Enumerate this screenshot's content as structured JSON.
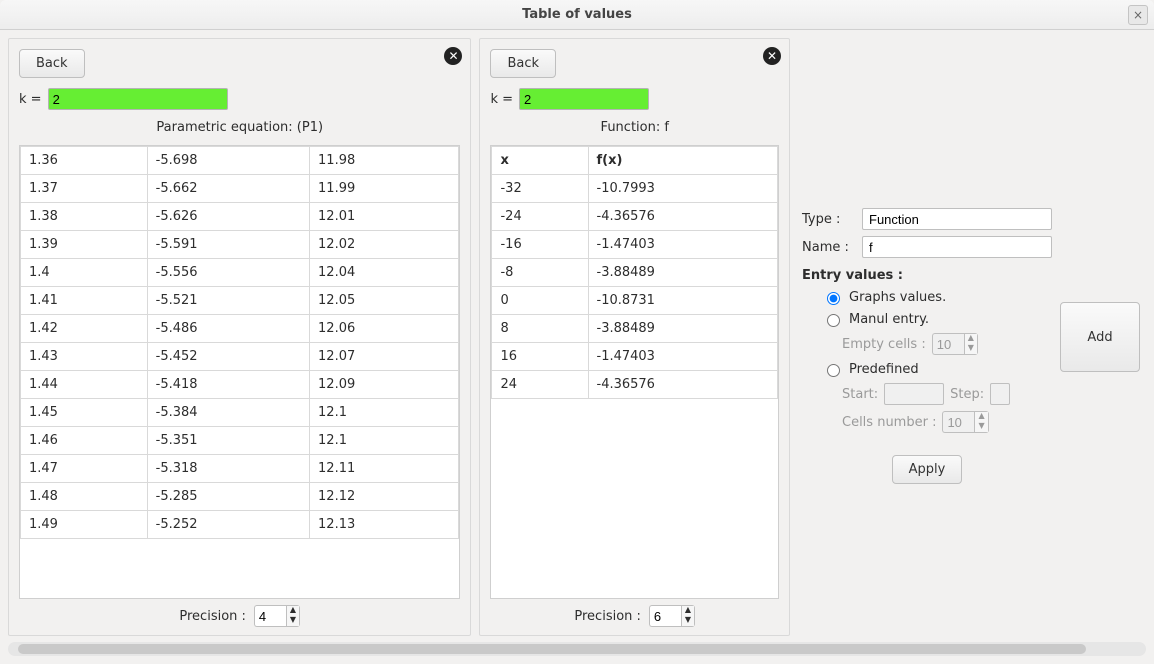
{
  "window": {
    "title": "Table of values",
    "close_glyph": "×"
  },
  "panel_left": {
    "close_glyph": "✕",
    "back_label": "Back",
    "k_label": "k = ",
    "k_value": "2",
    "title": "Parametric equation: (P1)",
    "precision_label": "Precision :",
    "precision_value": "4",
    "rows": [
      [
        "1.36",
        "-5.698",
        "11.98"
      ],
      [
        "1.37",
        "-5.662",
        "11.99"
      ],
      [
        "1.38",
        "-5.626",
        "12.01"
      ],
      [
        "1.39",
        "-5.591",
        "12.02"
      ],
      [
        "1.4",
        "-5.556",
        "12.04"
      ],
      [
        "1.41",
        "-5.521",
        "12.05"
      ],
      [
        "1.42",
        "-5.486",
        "12.06"
      ],
      [
        "1.43",
        "-5.452",
        "12.07"
      ],
      [
        "1.44",
        "-5.418",
        "12.09"
      ],
      [
        "1.45",
        "-5.384",
        "12.1"
      ],
      [
        "1.46",
        "-5.351",
        "12.1"
      ],
      [
        "1.47",
        "-5.318",
        "12.11"
      ],
      [
        "1.48",
        "-5.285",
        "12.12"
      ],
      [
        "1.49",
        "-5.252",
        "12.13"
      ]
    ]
  },
  "panel_middle": {
    "close_glyph": "✕",
    "back_label": "Back",
    "k_label": "k = ",
    "k_value": "2",
    "title": "Function: f",
    "precision_label": "Precision :",
    "precision_value": "6",
    "headers": [
      "x",
      "f(x)"
    ],
    "rows": [
      [
        "-32",
        "-10.7993"
      ],
      [
        "-24",
        "-4.36576"
      ],
      [
        "-16",
        "-1.47403"
      ],
      [
        "-8",
        "-3.88489"
      ],
      [
        "0",
        "-10.8731"
      ],
      [
        "8",
        "-3.88489"
      ],
      [
        "16",
        "-1.47403"
      ],
      [
        "24",
        "-4.36576"
      ]
    ]
  },
  "form": {
    "type_label": "Type :",
    "type_value": "Function",
    "name_label": "Name :",
    "name_value": "f",
    "entry_label": "Entry values :",
    "radio_graphs": "Graphs values.",
    "radio_manual": "Manul entry.",
    "empty_cells_label": "Empty cells :",
    "empty_cells_value": "10",
    "radio_predefined": "Predefined",
    "start_label": "Start:",
    "step_label": "Step:",
    "cells_number_label": "Cells number :",
    "cells_number_value": "10",
    "apply_label": "Apply"
  },
  "add_label": "Add"
}
